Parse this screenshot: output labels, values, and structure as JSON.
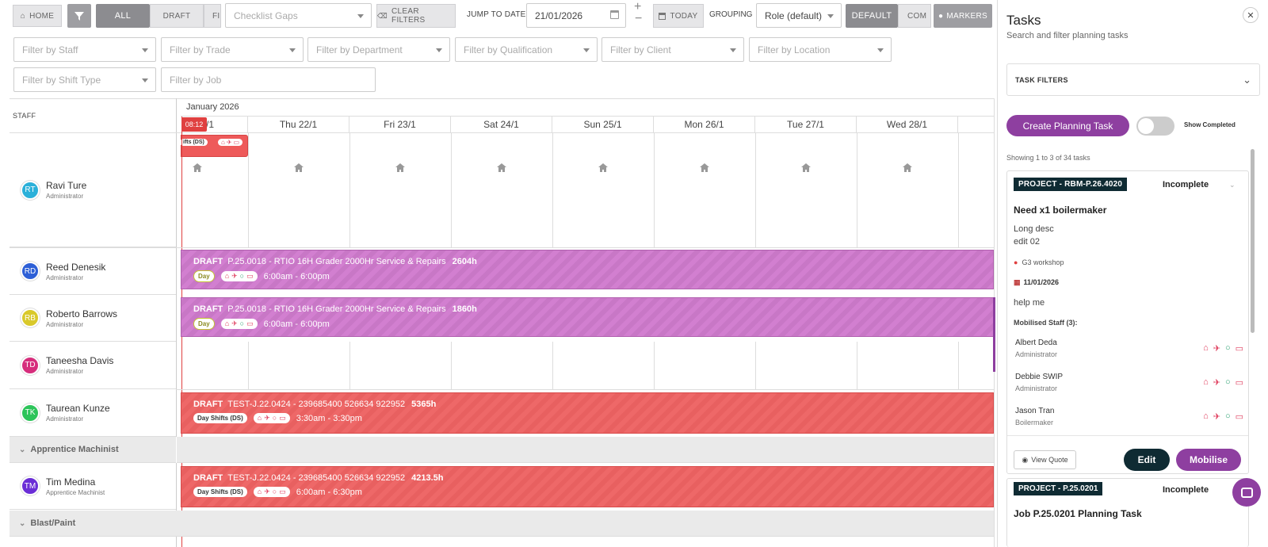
{
  "toolbar": {
    "home": "HOME",
    "view_all": "ALL",
    "view_draft": "DRAFT",
    "view_fi": "FI",
    "checklist_placeholder": "Checklist Gaps",
    "clear_filters": "CLEAR FILTERS",
    "jump_to_date_label": "JUMP TO DATE",
    "date_value": "21/01/2026",
    "today": "TODAY",
    "grouping_label": "GROUPING",
    "grouping_value": "Role (default)",
    "default": "DEFAULT",
    "com": "COM",
    "markers": "MARKERS"
  },
  "filters": {
    "staff": "Filter by Staff",
    "trade": "Filter by Trade",
    "department": "Filter by Department",
    "qualification": "Filter by Qualification",
    "client": "Filter by Client",
    "location": "Filter by Location",
    "shift_type": "Filter by Shift Type",
    "job": "Filter by Job"
  },
  "calendar": {
    "staff_header": "STAFF",
    "month": "January 2026",
    "current_time": "08:12",
    "first_day_partial": "/1",
    "days": [
      "Thu 22/1",
      "Fri 23/1",
      "Sat 24/1",
      "Sun 25/1",
      "Mon 26/1",
      "Tue 27/1",
      "Wed 28/1"
    ],
    "partial_chip": "ifts (DS)"
  },
  "staff": [
    {
      "initials": "RT",
      "name": "Ravi Ture",
      "role": "Administrator",
      "color": "#2bb0d9"
    },
    {
      "initials": "RD",
      "name": "Reed Denesik",
      "role": "Administrator",
      "color": "#2d5fd6"
    },
    {
      "initials": "RB",
      "name": "Roberto Barrows",
      "role": "Administrator",
      "color": "#d9c92b"
    },
    {
      "initials": "TD",
      "name": "Taneesha Davis",
      "role": "Administrator",
      "color": "#d62d7c"
    },
    {
      "initials": "TK",
      "name": "Taurean Kunze",
      "role": "Administrator",
      "color": "#2dc45a"
    }
  ],
  "group1": {
    "label": "Apprentice Machinist",
    "staff": {
      "initials": "TM",
      "name": "Tim Medina",
      "role": "Apprentice Machinist",
      "color": "#6a2dd6"
    }
  },
  "group2": {
    "label": "Blast/Paint"
  },
  "shifts": [
    {
      "status": "DRAFT",
      "job": "P.25.0018 - RTIO 16H Grader 2000Hr Service & Repairs",
      "hours": "2604h",
      "shift": "Day",
      "time": "6:00am - 6:00pm"
    },
    {
      "status": "DRAFT",
      "job": "P.25.0018 - RTIO 16H Grader 2000Hr Service & Repairs",
      "hours": "1860h",
      "shift": "Day",
      "time": "6:00am - 6:00pm"
    },
    {
      "status": "DRAFT",
      "job": "TEST-J.22.0424 - 239685400 526634 922952",
      "hours": "5365h",
      "shift": "Day Shifts (DS)",
      "time": "3:30am - 3:30pm"
    },
    {
      "status": "DRAFT",
      "job": "TEST-J.22.0424 - 239685400 526634 922952",
      "hours": "4213.5h",
      "shift": "Day Shifts (DS)",
      "time": "6:00am - 6:30pm"
    }
  ],
  "panel": {
    "title": "Tasks",
    "subtitle": "Search and filter planning tasks",
    "filters_label": "TASK FILTERS",
    "create_button": "Create Planning Task",
    "show_completed": "Show Completed",
    "showing": "Showing 1 to 3 of 34 tasks",
    "task1": {
      "tag": "PROJECT - RBM-P.26.4020",
      "status": "Incomplete",
      "title": "Need x1 boilermaker",
      "desc1": "Long desc",
      "desc2": "edit 02",
      "location": "G3 workshop",
      "date": "11/01/2026",
      "note": "help me",
      "mobilised_label": "Mobilised Staff (3):",
      "mobilised": [
        {
          "name": "Albert Deda",
          "role": "Administrator"
        },
        {
          "name": "Debbie SWIP",
          "role": "Administrator"
        },
        {
          "name": "Jason Tran",
          "role": "Boilermaker"
        }
      ],
      "view_quote": "View Quote",
      "edit": "Edit",
      "mobilise": "Mobilise"
    },
    "task2": {
      "tag": "PROJECT - P.25.0201",
      "status": "Incomplete",
      "title": "Job P.25.0201 Planning Task"
    }
  },
  "colors": {
    "accent": "#8e3fa0",
    "draft_pink": "#c877c6",
    "draft_red": "#e86060",
    "dark": "#0f2b33",
    "now_line": "#e04040"
  }
}
